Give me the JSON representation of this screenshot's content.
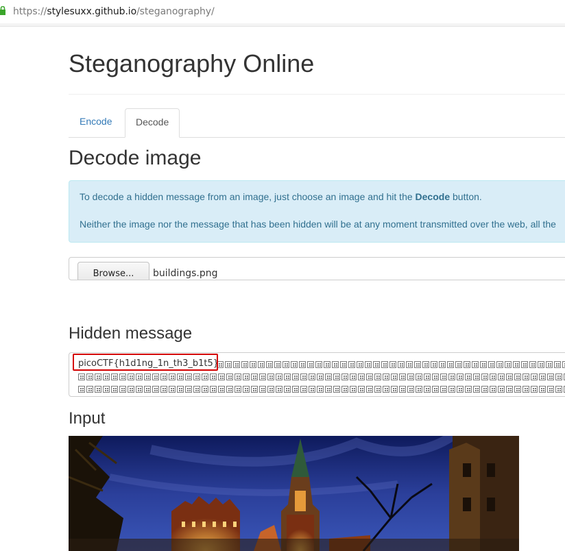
{
  "browser": {
    "url_prefix": "https://",
    "url_host": "stylesuxx.github.io",
    "url_path": "/steganography/"
  },
  "page": {
    "title": "Steganography Online"
  },
  "tabs": [
    {
      "label": "Encode",
      "active": false
    },
    {
      "label": "Decode",
      "active": true
    }
  ],
  "decode": {
    "heading": "Decode image",
    "info_line1_before": "To decode a hidden message from an image, just choose an image and hit the ",
    "info_line1_bold": "Decode",
    "info_line1_after": " button.",
    "info_line2": "Neither the image nor the message that has been hidden will be at any moment transmitted over the web, all the"
  },
  "file_input": {
    "button_label": "Browse...",
    "file_name": "buildings.png"
  },
  "hidden_message": {
    "heading": "Hidden message",
    "text": "picoCTF{h1d1ng_1n_th3_b1t5}"
  },
  "input_section": {
    "heading": "Input"
  },
  "colors": {
    "link": "#337ab7",
    "info_bg": "#d9edf7",
    "info_text": "#31708f",
    "highlight": "#d40000"
  }
}
